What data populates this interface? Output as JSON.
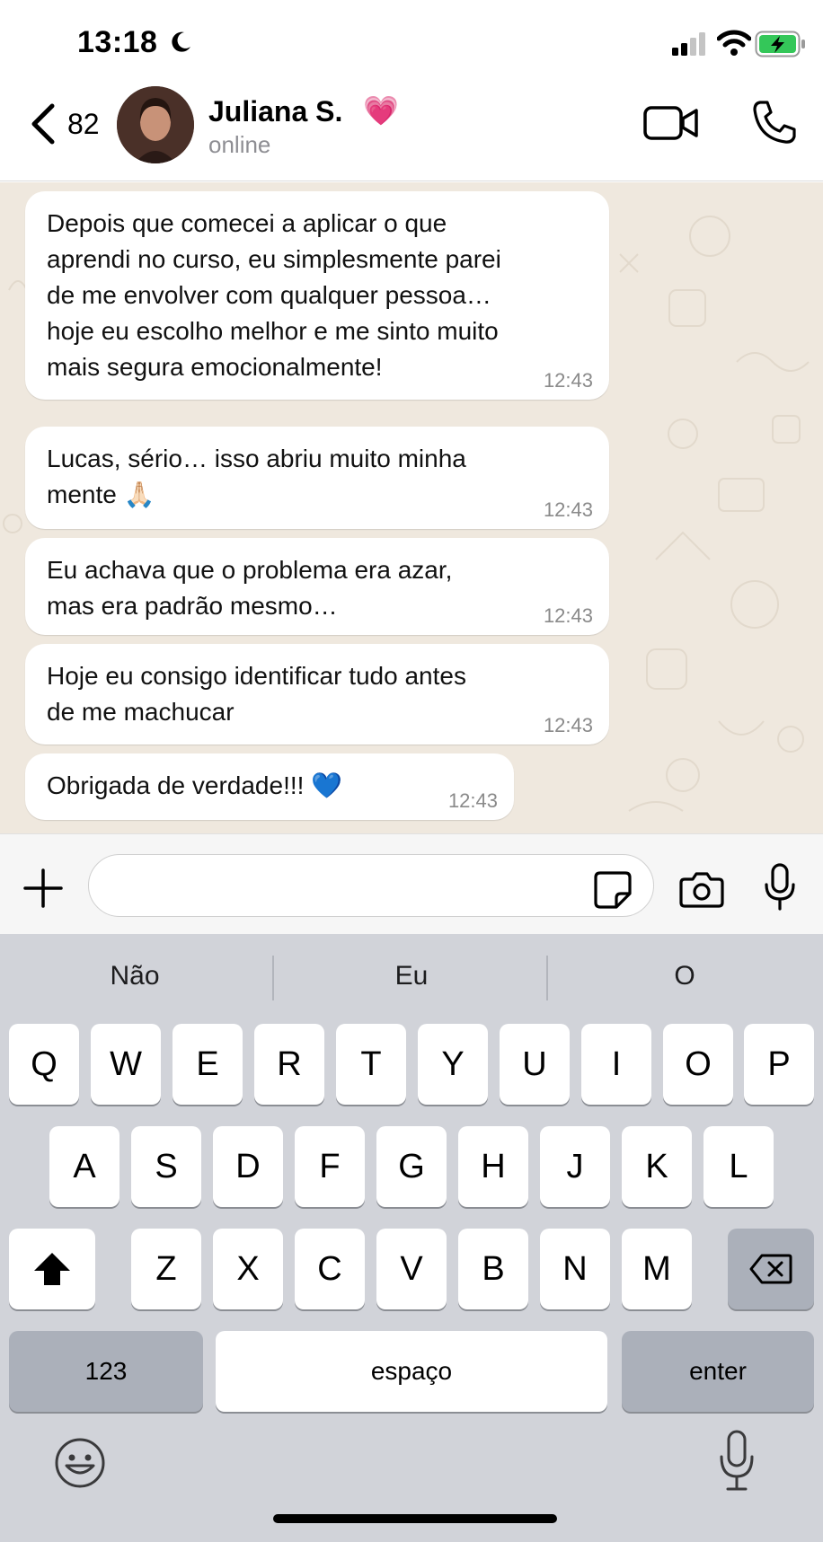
{
  "status_bar": {
    "time": "13:18"
  },
  "header": {
    "unread_count": "82",
    "contact_name": "Juliana S.",
    "name_emoji": "💗",
    "status": "online"
  },
  "messages": [
    {
      "text": "Depois que comecei a aplicar o que\naprendi no curso, eu simplesmente parei\nde me envolver com qualquer pessoa…\nhoje eu escolho melhor e me sinto muito\nmais segura emocionalmente!",
      "time": "12:43"
    },
    {
      "text": "Lucas, sério… isso abriu muito minha\nmente 🙏🏻",
      "time": "12:43"
    },
    {
      "text": "Eu achava que o problema era azar,\nmas era padrão mesmo…",
      "time": "12:43"
    },
    {
      "text": "Hoje eu consigo identificar tudo antes\nde me machucar",
      "time": "12:43"
    },
    {
      "text": "Obrigada de verdade!!! 💙",
      "time": "12:43"
    }
  ],
  "input": {
    "value": "",
    "placeholder": ""
  },
  "keyboard": {
    "suggestions": [
      "Não",
      "Eu",
      "O"
    ],
    "row1": [
      "Q",
      "W",
      "E",
      "R",
      "T",
      "Y",
      "U",
      "I",
      "O",
      "P"
    ],
    "row2": [
      "A",
      "S",
      "D",
      "F",
      "G",
      "H",
      "J",
      "K",
      "L"
    ],
    "row3": [
      "Z",
      "X",
      "C",
      "V",
      "B",
      "N",
      "M"
    ],
    "numbers_key": "123",
    "space_key": "espaço",
    "enter_key": "enter"
  },
  "colors": {
    "chat_background": "#efe8de",
    "bubble": "#ffffff",
    "keyboard": "#d1d3d9",
    "battery_green": "#34c759"
  }
}
